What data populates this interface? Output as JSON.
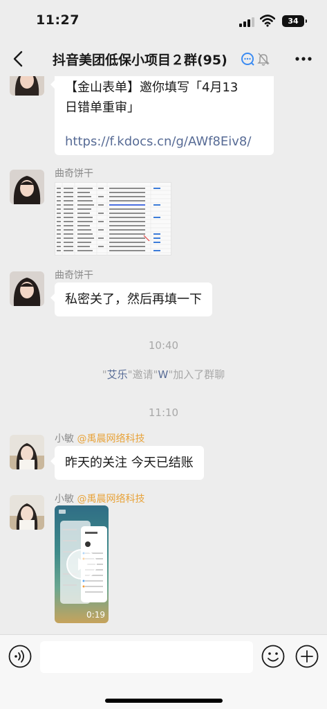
{
  "status_bar": {
    "time": "11:27",
    "battery": "34"
  },
  "nav": {
    "title": "抖音美团低保小项目２群(95)"
  },
  "messages": [
    {
      "type": "text",
      "text_line1": "【金山表单】邀你填写「4月13",
      "text_line2": "日错单重审」",
      "link": "https://f.kdocs.cn/g/AWf8Eiv8/"
    },
    {
      "type": "image",
      "sender": "曲奇饼干"
    },
    {
      "type": "text",
      "sender": "曲奇饼干",
      "text": "私密关了，然后再填一下"
    },
    {
      "type": "timestamp",
      "text": "10:40"
    },
    {
      "type": "system",
      "q1": "\"",
      "inviter": "艾乐",
      "mid": "\"邀请\"",
      "invitee": "W",
      "tail": "\"加入了群聊"
    },
    {
      "type": "timestamp",
      "text": "11:10"
    },
    {
      "type": "text",
      "sender": "小敏",
      "mention": "@禹晨网络科技",
      "text": "昨天的关注 今天已结账"
    },
    {
      "type": "video",
      "sender": "小敏",
      "mention": "@禹晨网络科技",
      "duration": "0:19"
    }
  ],
  "colors": {
    "background": "#ededed",
    "bubble": "#ffffff",
    "link": "#576b95",
    "mention": "#e8a33a"
  }
}
